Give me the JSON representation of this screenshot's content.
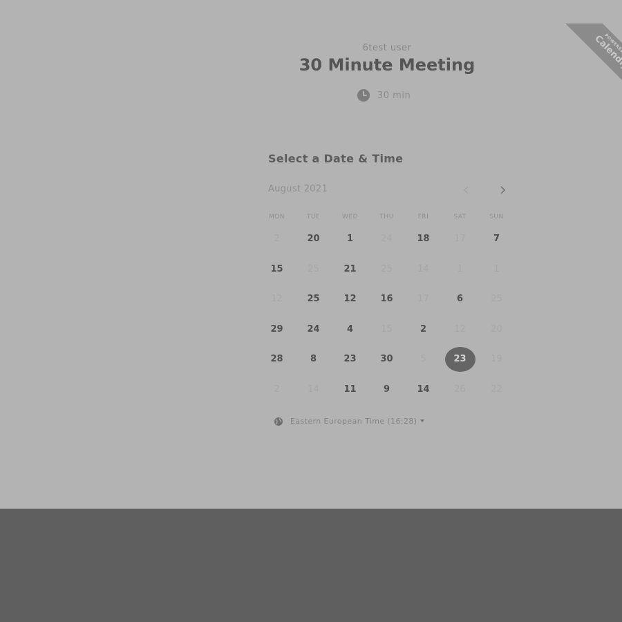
{
  "ribbon": {
    "small_text": "POWERED BY",
    "brand": "Calendly"
  },
  "event": {
    "owner": "6test user",
    "title": "30 Minute Meeting",
    "duration": "30 min",
    "icon": "clock-icon"
  },
  "calendar": {
    "heading": "Select a Date & Time",
    "month": "August 2021",
    "prev_icon": "chevron-left-icon",
    "next_icon": "chevron-right-icon",
    "weekdays": [
      "MON",
      "TUE",
      "WED",
      "THU",
      "FRI",
      "SAT",
      "SUN"
    ],
    "rows": [
      [
        {
          "d": "2",
          "s": "unavailable"
        },
        {
          "d": "20",
          "s": "available"
        },
        {
          "d": "1",
          "s": "available"
        },
        {
          "d": "24",
          "s": "unavailable"
        },
        {
          "d": "18",
          "s": "available"
        },
        {
          "d": "17",
          "s": "unavailable"
        },
        {
          "d": "7",
          "s": "available"
        }
      ],
      [
        {
          "d": "15",
          "s": "available"
        },
        {
          "d": "25",
          "s": "unavailable"
        },
        {
          "d": "21",
          "s": "available"
        },
        {
          "d": "25",
          "s": "unavailable"
        },
        {
          "d": "14",
          "s": "unavailable"
        },
        {
          "d": "1",
          "s": "unavailable"
        },
        {
          "d": "1",
          "s": "unavailable"
        }
      ],
      [
        {
          "d": "12",
          "s": "unavailable"
        },
        {
          "d": "25",
          "s": "available"
        },
        {
          "d": "12",
          "s": "available"
        },
        {
          "d": "16",
          "s": "available"
        },
        {
          "d": "17",
          "s": "unavailable"
        },
        {
          "d": "6",
          "s": "available"
        },
        {
          "d": "25",
          "s": "unavailable"
        }
      ],
      [
        {
          "d": "29",
          "s": "available"
        },
        {
          "d": "24",
          "s": "available"
        },
        {
          "d": "4",
          "s": "available"
        },
        {
          "d": "15",
          "s": "unavailable"
        },
        {
          "d": "2",
          "s": "available"
        },
        {
          "d": "12",
          "s": "unavailable"
        },
        {
          "d": "20",
          "s": "unavailable"
        }
      ],
      [
        {
          "d": "28",
          "s": "available"
        },
        {
          "d": "8",
          "s": "available"
        },
        {
          "d": "23",
          "s": "available"
        },
        {
          "d": "30",
          "s": "available"
        },
        {
          "d": "5",
          "s": "unavailable"
        },
        {
          "d": "23",
          "s": "selected"
        },
        {
          "d": "19",
          "s": "unavailable"
        }
      ],
      [
        {
          "d": "2",
          "s": "unavailable"
        },
        {
          "d": "14",
          "s": "unavailable"
        },
        {
          "d": "11",
          "s": "available"
        },
        {
          "d": "9",
          "s": "available"
        },
        {
          "d": "14",
          "s": "available"
        },
        {
          "d": "26",
          "s": "unavailable"
        },
        {
          "d": "22",
          "s": "unavailable"
        }
      ]
    ]
  },
  "timezone": {
    "label": "Eastern European Time (16:28)",
    "icon": "globe-icon"
  },
  "colors": {
    "panel_bg": "#b3b3b3",
    "page_bg": "#5f5f5f",
    "selected_day_bg": "#656565"
  }
}
